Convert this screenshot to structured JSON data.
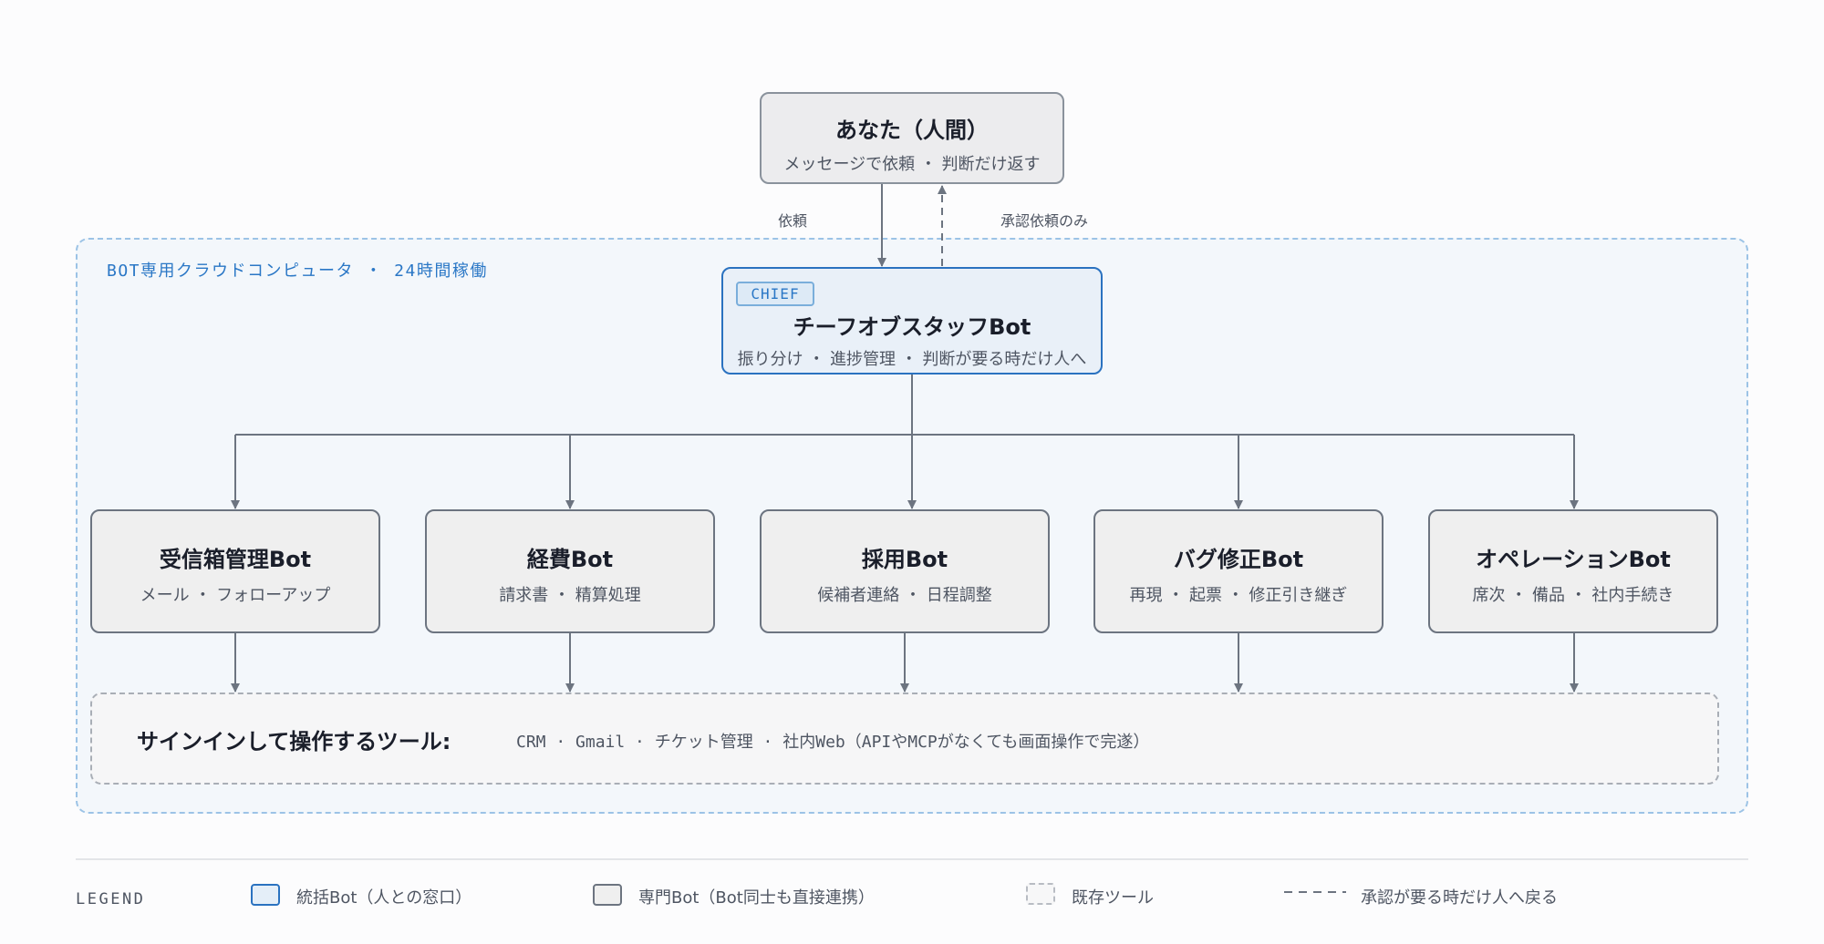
{
  "cloud": {
    "label": "BOT専用クラウドコンピュータ ・ 24時間稼働"
  },
  "human": {
    "title": "あなた（人間）",
    "sub": "メッセージで依頼 ・ 判断だけ返す"
  },
  "edges": {
    "request": "依頼",
    "approval_only": "承認依頼のみ"
  },
  "chief": {
    "tag": "CHIEF",
    "title": "チーフオブスタッフBot",
    "sub": "振り分け ・ 進捗管理 ・ 判断が要る時だけ人へ"
  },
  "specialists": [
    {
      "title": "受信箱管理Bot",
      "sub": "メール ・ フォローアップ"
    },
    {
      "title": "経費Bot",
      "sub": "請求書 ・ 精算処理"
    },
    {
      "title": "採用Bot",
      "sub": "候補者連絡 ・ 日程調整"
    },
    {
      "title": "バグ修正Bot",
      "sub": "再現 ・ 起票 ・ 修正引き継ぎ"
    },
    {
      "title": "オペレーションBot",
      "sub": "席次 ・ 備品 ・ 社内手続き"
    }
  ],
  "tools": {
    "label": "サインインして操作するツール:",
    "list": "CRM · Gmail · チケット管理 · 社内Web（APIやMCPがなくても画面操作で完遂）"
  },
  "legend": {
    "title": "LEGEND",
    "items": [
      {
        "label": "統括Bot（人との窓口）"
      },
      {
        "label": "専門Bot（Bot同士も直接連携）"
      },
      {
        "label": "既存ツール"
      },
      {
        "label": "承認が要る時だけ人へ戻る"
      }
    ]
  },
  "colors": {
    "chief_border": "#2a72c0",
    "cloud_border": "#9cc3e6",
    "node_border": "#6c7480",
    "edge": "#6c7480"
  }
}
